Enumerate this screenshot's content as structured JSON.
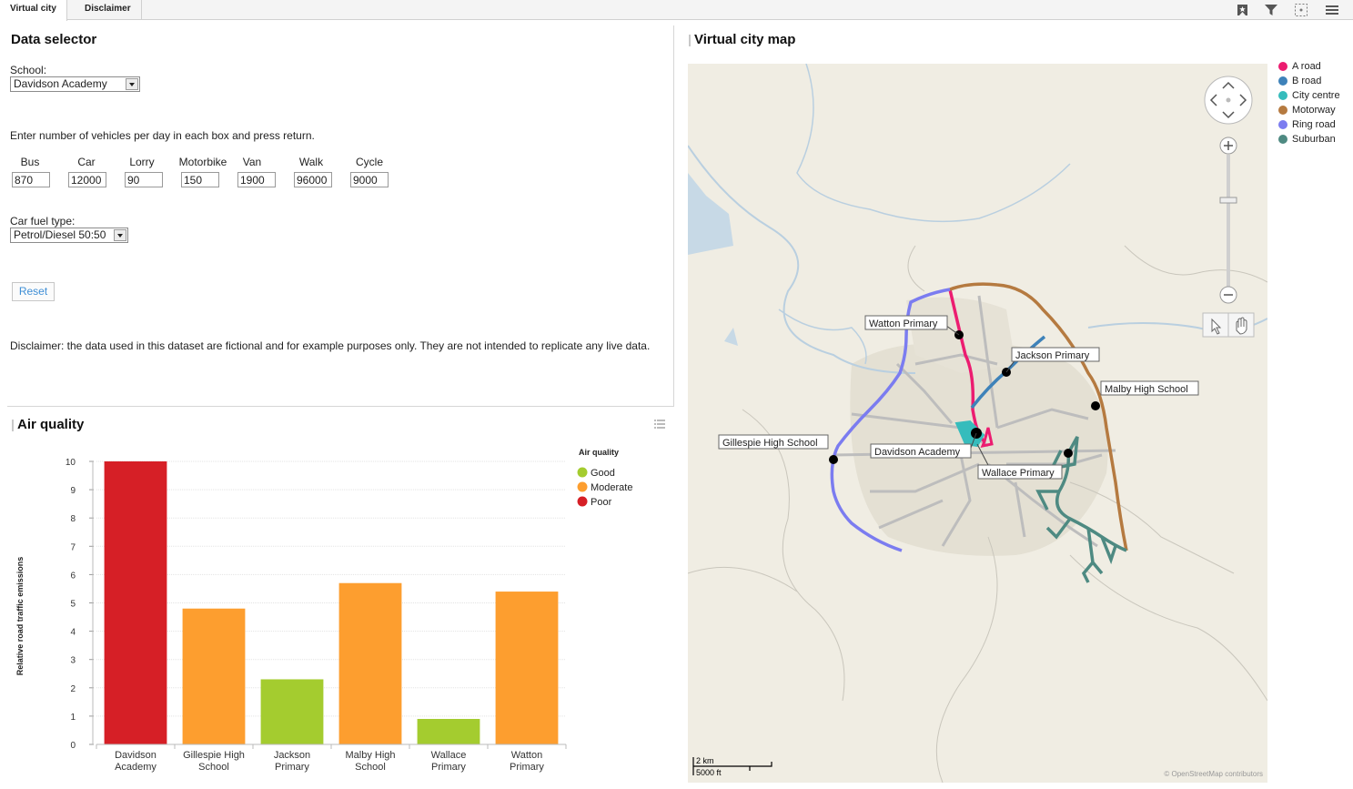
{
  "tabs": [
    {
      "label": "Virtual city",
      "active": true
    },
    {
      "label": "Disclaimer",
      "active": false
    }
  ],
  "toolbar_icons": [
    "bookmark-icon",
    "filter-icon",
    "select-icon",
    "menu-icon"
  ],
  "data_selector": {
    "title": "Data selector",
    "school_label": "School:",
    "school_value": "Davidson Academy",
    "instructions": "Enter number of vehicles per day in each box and press return.",
    "vehicles": [
      {
        "label": "Bus",
        "value": "870"
      },
      {
        "label": "Car",
        "value": "12000"
      },
      {
        "label": "Lorry",
        "value": "90"
      },
      {
        "label": "Motorbike",
        "value": "150"
      },
      {
        "label": "Van",
        "value": "1900"
      },
      {
        "label": "Walk",
        "value": "96000"
      },
      {
        "label": "Cycle",
        "value": "9000"
      }
    ],
    "fuel_label": "Car fuel type:",
    "fuel_value": "Petrol/Diesel 50:50",
    "reset_label": "Reset",
    "disclaimer": "Disclaimer: the data used in this dataset are fictional and for example purposes only. They are not intended to replicate any live data."
  },
  "air_quality": {
    "title": "Air quality",
    "legend_title": "Air quality",
    "legend": [
      {
        "label": "Good",
        "color": "#a4cc2f"
      },
      {
        "label": "Moderate",
        "color": "#fd9e2f"
      },
      {
        "label": "Poor",
        "color": "#d61f26"
      }
    ]
  },
  "chart_data": {
    "type": "bar",
    "title": "Air quality",
    "ylabel": "Relative road traffic emissions",
    "xlabel": "",
    "ylim": [
      0,
      10
    ],
    "yticks": [
      0,
      1,
      2,
      3,
      4,
      5,
      6,
      7,
      8,
      9,
      10
    ],
    "categories": [
      [
        "Davidson",
        "Academy"
      ],
      [
        "Gillespie High",
        "School"
      ],
      [
        "Jackson",
        "Primary"
      ],
      [
        "Malby High",
        "School"
      ],
      [
        "Wallace",
        "Primary"
      ],
      [
        "Watton",
        "Primary"
      ]
    ],
    "values": [
      10,
      4.8,
      2.3,
      5.7,
      0.9,
      5.4
    ],
    "quality": [
      "Poor",
      "Moderate",
      "Good",
      "Moderate",
      "Good",
      "Moderate"
    ],
    "grid": true,
    "legend_position": "top-right"
  },
  "map": {
    "title": "Virtual city map",
    "legend": [
      {
        "label": "A road",
        "color": "#ec1c70"
      },
      {
        "label": "B road",
        "color": "#3e82b9"
      },
      {
        "label": "City centre",
        "color": "#36bcbc"
      },
      {
        "label": "Motorway",
        "color": "#b57a40"
      },
      {
        "label": "Ring road",
        "color": "#7b7cf0"
      },
      {
        "label": "Suburban",
        "color": "#4e8a82"
      }
    ],
    "schools": [
      "Watton Primary",
      "Jackson Primary",
      "Malby High School",
      "Gillespie High School",
      "Davidson Academy",
      "Wallace Primary"
    ],
    "scale_km": "2 km",
    "scale_ft": "5000 ft",
    "attribution": "© OpenStreetMap contributors"
  }
}
